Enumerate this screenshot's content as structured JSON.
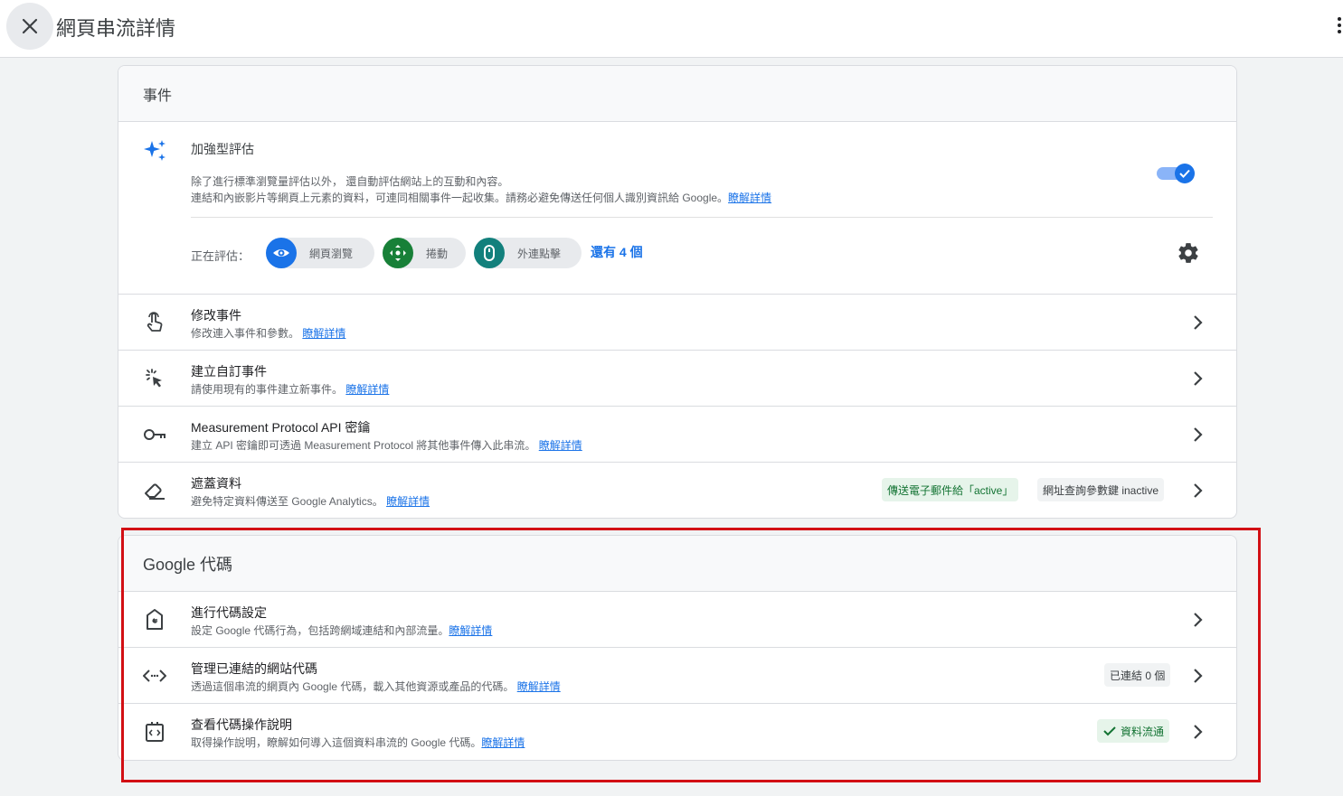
{
  "header": {
    "title": "網頁串流詳情"
  },
  "events": {
    "header": "事件",
    "enhanced": {
      "title": "加強型評估",
      "desc_line1": "除了進行標準瀏覽量評估以外， 還自動評估網站上的互動和內容。",
      "desc_line2": "連結和內嵌影片等網頁上元素的資料，可連同相關事件一起收集。請務必避免傳送任何個人識別資訊給 Google。",
      "learn_more": "瞭解詳情",
      "enabled": true,
      "measuring_label": "正在評估：",
      "chips": [
        {
          "label": "網頁瀏覽",
          "icon": "eye-icon",
          "color": "#1a73e8"
        },
        {
          "label": "捲動",
          "icon": "scroll-icon",
          "color": "#188038"
        },
        {
          "label": "外連點擊",
          "icon": "mouse-icon",
          "color": "#12807c"
        }
      ],
      "more_link": "還有 4 個"
    },
    "rows": [
      {
        "title": "修改事件",
        "desc": "修改連入事件和參數。",
        "link": "瞭解詳情",
        "icon": "touch-hand-icon"
      },
      {
        "title": "建立自訂事件",
        "desc": "請使用現有的事件建立新事件。",
        "link": "瞭解詳情",
        "icon": "click-cursor-icon"
      },
      {
        "title": "Measurement Protocol API 密鑰",
        "desc": "建立 API 密鑰即可透過 Measurement Protocol 將其他事件傳入此串流。",
        "link": "瞭解詳情",
        "icon": "key-icon"
      },
      {
        "title": "遮蓋資料",
        "desc": "避免特定資料傳送至 Google Analytics。",
        "link": "瞭解詳情",
        "icon": "eraser-icon",
        "badges": [
          "傳送電子郵件給「active」",
          "網址查詢參數鍵 inactive"
        ]
      }
    ]
  },
  "tag": {
    "header": "Google 代碼",
    "rows": [
      {
        "title": "進行代碼設定",
        "desc": "設定 Google 代碼行為，包括跨網域連結和內部流量。",
        "link": "瞭解詳情",
        "icon": "google-tag-icon"
      },
      {
        "title": "管理已連結的網站代碼",
        "desc": "透過這個串流的網頁內 Google 代碼，載入其他資源或產品的代碼。",
        "link": "瞭解詳情",
        "icon": "code-icon",
        "badge": "已連結 0 個"
      },
      {
        "title": "查看代碼操作說明",
        "desc": "取得操作說明，瞭解如何導入這個資料串流的 Google 代碼。",
        "link": "瞭解詳情",
        "icon": "code-box-icon",
        "badge": "資料流通"
      }
    ]
  },
  "colors": {
    "highlight": "#d20f14",
    "accent": "#1a73e8"
  }
}
